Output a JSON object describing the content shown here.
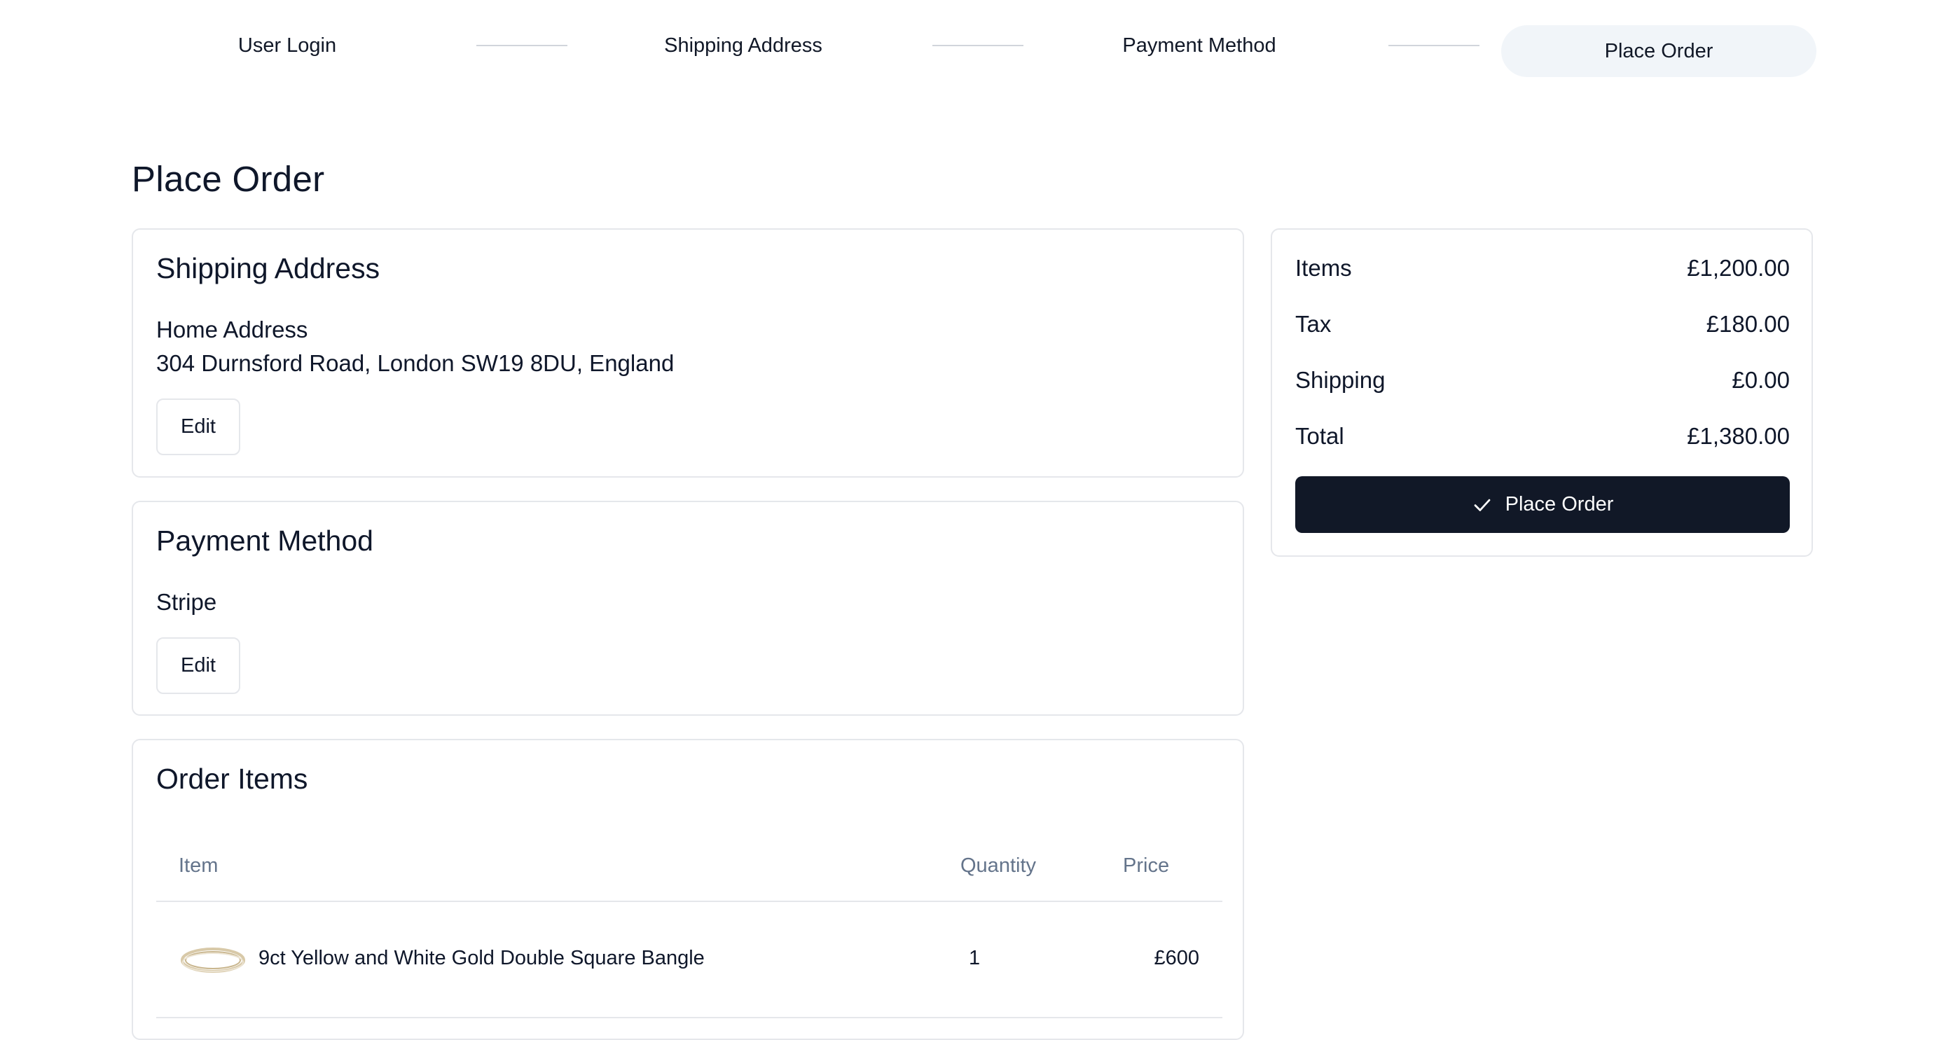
{
  "stepper": {
    "steps": [
      {
        "label": "User Login"
      },
      {
        "label": "Shipping Address"
      },
      {
        "label": "Payment Method"
      },
      {
        "label": "Place Order",
        "active": true
      }
    ]
  },
  "page": {
    "title": "Place Order"
  },
  "shipping": {
    "title": "Shipping Address",
    "address_name": "Home Address",
    "address_line": "304 Durnsford Road, London SW19 8DU, England",
    "edit_label": "Edit"
  },
  "payment": {
    "title": "Payment Method",
    "method": "Stripe",
    "edit_label": "Edit"
  },
  "order_items": {
    "title": "Order Items",
    "columns": {
      "item": "Item",
      "quantity": "Quantity",
      "price": "Price"
    },
    "rows": [
      {
        "thumbnail_icon": "gold-bangle-icon",
        "name": "9ct Yellow and White Gold Double Square Bangle",
        "quantity": "1",
        "price": "£600"
      }
    ]
  },
  "summary": {
    "items_label": "Items",
    "items_value": "£1,200.00",
    "tax_label": "Tax",
    "tax_value": "£180.00",
    "shipping_label": "Shipping",
    "shipping_value": "£0.00",
    "total_label": "Total",
    "total_value": "£1,380.00",
    "place_order_label": "Place Order",
    "place_order_icon": "check-icon"
  },
  "colors": {
    "primary_button": "#111827",
    "active_step_bg": "#f1f5f9",
    "muted_text": "#64748b",
    "border": "#e5e7eb"
  }
}
